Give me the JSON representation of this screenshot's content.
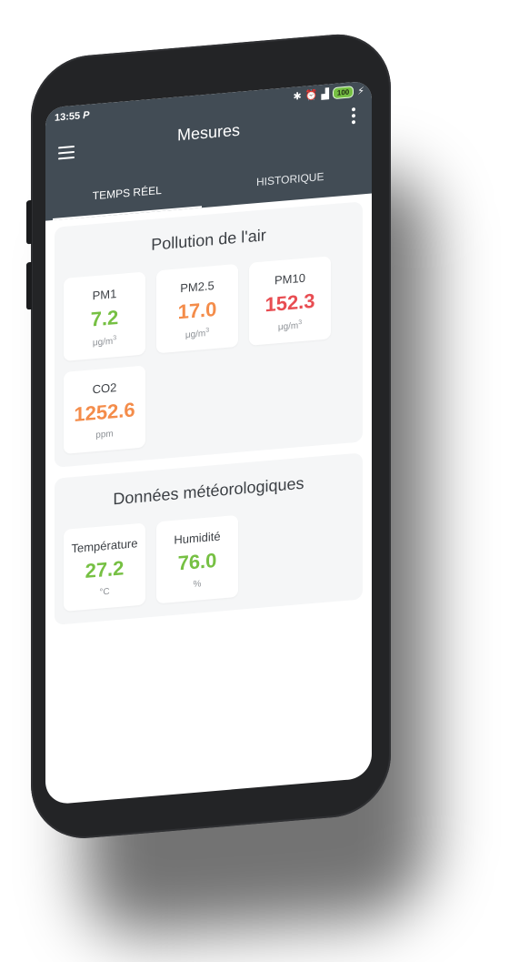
{
  "status_bar": {
    "time": "13:55",
    "notification": "P",
    "battery": "100",
    "icons": [
      "bluetooth-icon",
      "alarm-off-icon",
      "signal-icon",
      "battery-icon",
      "charging-icon"
    ]
  },
  "toolbar": {
    "title": "Mesures"
  },
  "tabs": [
    {
      "label": "TEMPS RÉEL",
      "active": true
    },
    {
      "label": "HISTORIQUE",
      "active": false
    }
  ],
  "air_pollution": {
    "title": "Pollution de l'air",
    "cards": [
      {
        "label": "PM1",
        "value": "7.2",
        "unit": "μg/m",
        "unit_exp": "3",
        "status": "green",
        "color": "#76c043"
      },
      {
        "label": "PM2.5",
        "value": "17.0",
        "unit": "μg/m",
        "unit_exp": "3",
        "status": "orange",
        "color": "#f48c4a"
      },
      {
        "label": "PM10",
        "value": "152.3",
        "unit": "μg/m",
        "unit_exp": "3",
        "status": "red",
        "color": "#e84d52"
      },
      {
        "label": "CO2",
        "value": "1252.6",
        "unit": "ppm",
        "unit_exp": "",
        "status": "orange",
        "color": "#f48c4a"
      }
    ]
  },
  "weather": {
    "title": "Données météorologiques",
    "cards": [
      {
        "label": "Température",
        "value": "27.2",
        "unit": "°C",
        "status": "green",
        "color": "#76c043"
      },
      {
        "label": "Humidité",
        "value": "76.0",
        "unit": "%",
        "status": "green",
        "color": "#76c043"
      }
    ]
  },
  "colors": {
    "appbar": "#424c55",
    "good": "#76c043",
    "moderate": "#f48c4a",
    "bad": "#e84d52"
  }
}
